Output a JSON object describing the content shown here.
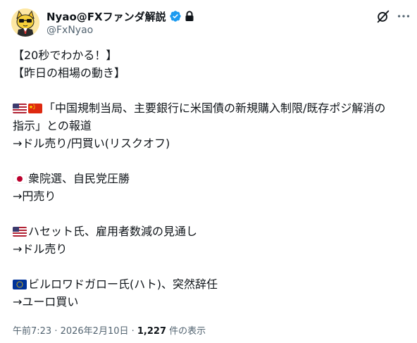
{
  "author": {
    "display_name": "Nyao@FXファンダ解説",
    "handle": "@FxNyao"
  },
  "icons": {
    "avatar": "cat-avatar",
    "verified": "verified-badge-icon",
    "lock": "lock-icon",
    "grok": "grok-icon",
    "more": "more-icon"
  },
  "post": {
    "line1": "【20秒でわかる！】",
    "line2": "【昨日の相場の動き】",
    "item1_line1": "「中国規制当局、主要銀行に米国債の新規購入制限/既存ポジ解消の",
    "item1_line2": "指示」との報道",
    "item1_line3": "→ドル売り/円買い(リスクオフ)",
    "item2_line1": "衆院選、自民党圧勝",
    "item2_line2": "→円売り",
    "item3_line1": "ハセット氏、雇用者数減の見通し",
    "item3_line2": "→ドル売り",
    "item4_line1": "ビルロワドガロー氏(ハト)、突然辞任",
    "item4_line2": "→ユーロ買い"
  },
  "meta": {
    "time_date": "午前7:23 · 2026年2月10日 · ",
    "views_count": "1,227",
    "views_label": " 件の表示"
  },
  "colors": {
    "verified": "#1d9bf0",
    "text_primary": "#0f1419",
    "text_secondary": "#536471"
  }
}
